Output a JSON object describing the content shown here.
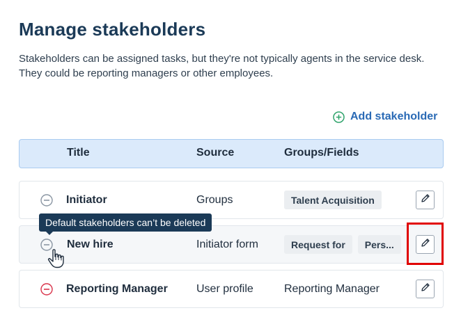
{
  "page": {
    "title": "Manage stakeholders",
    "description": "Stakeholders can be assigned tasks, but they're not typically agents in the service desk. They could be reporting managers or other employees."
  },
  "actions": {
    "add_stakeholder": "Add stakeholder",
    "add_icon": "plus-circle-icon"
  },
  "table": {
    "columns": [
      "Title",
      "Source",
      "Groups/Fields"
    ],
    "rows": [
      {
        "title": "Initiator",
        "source": "Groups",
        "groups": [
          "Talent Acquisition"
        ],
        "remove_icon": "minus-circle-icon",
        "removable": false
      },
      {
        "title": "New hire",
        "source": "Initiator form",
        "groups": [
          "Request for",
          "Pers..."
        ],
        "remove_icon": "minus-circle-icon",
        "removable": false
      },
      {
        "title": "Reporting Manager",
        "source": "User profile",
        "groups_text": "Reporting Manager",
        "remove_icon": "minus-circle-icon",
        "removable": true
      }
    ]
  },
  "tooltip": {
    "text": "Default stakeholders can’t be deleted"
  },
  "colors": {
    "accent": "#2a6ab5",
    "add_icon": "#2fa36b",
    "remove_enabled": "#d9334a",
    "remove_disabled": "#8a96a3",
    "highlight": "#e00000"
  }
}
